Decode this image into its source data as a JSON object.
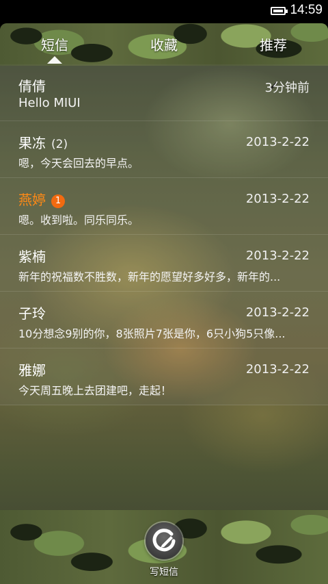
{
  "status_bar": {
    "time": "14:59",
    "battery_icon": "battery-icon"
  },
  "tabs": [
    {
      "label": "短信",
      "active": true
    },
    {
      "label": "收藏",
      "active": false
    },
    {
      "label": "推荐",
      "active": false
    }
  ],
  "conversations": [
    {
      "name": "倩倩",
      "count": "",
      "date": "3分钟前",
      "preview": "Hello MIUI",
      "unread": "",
      "draft_icon": "pencil-icon"
    },
    {
      "name": "果冻",
      "count": "(2)",
      "date": "2013-2-22",
      "preview": "嗯，今天会回去的早点。",
      "unread": ""
    },
    {
      "name": "燕婷",
      "count": "",
      "date": "2013-2-22",
      "preview": "嗯。收到啦。同乐同乐。",
      "unread": "1"
    },
    {
      "name": "紫楠",
      "count": "",
      "date": "2013-2-22",
      "preview": "新年的祝福数不胜数，新年的愿望好多好多，新年的...",
      "unread": ""
    },
    {
      "name": "子玲",
      "count": "",
      "date": "2013-2-22",
      "preview": "10分想念9别的你，8张照片7张是你，6只小狗5只像...",
      "unread": ""
    },
    {
      "name": "雅娜",
      "count": "",
      "date": "2013-2-22",
      "preview": "今天周五晚上去团建吧，走起！",
      "unread": ""
    }
  ],
  "compose": {
    "label": "写短信",
    "icon": "compose-icon"
  },
  "colors": {
    "unread_accent": "#ff8a16",
    "badge": "#f26a10"
  }
}
